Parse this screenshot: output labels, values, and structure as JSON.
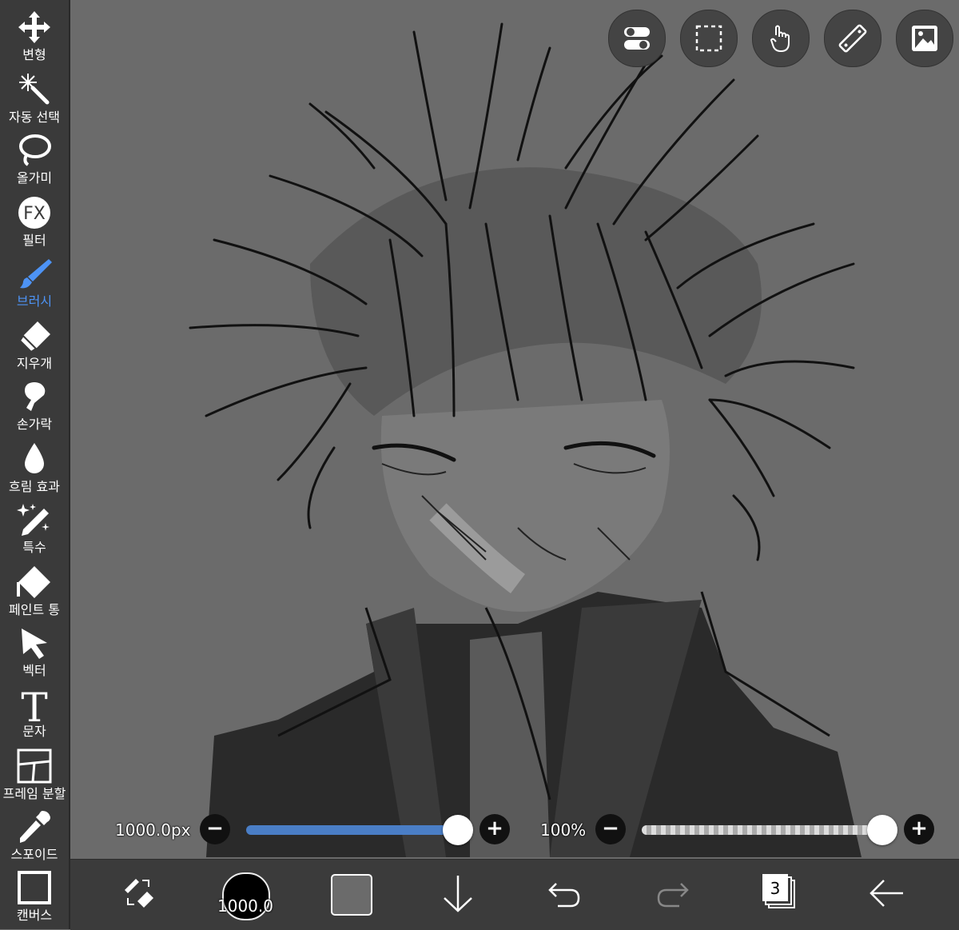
{
  "sidebar": {
    "tools": [
      {
        "id": "transform",
        "label": "변형",
        "icon": "move-arrows-icon"
      },
      {
        "id": "magic-wand",
        "label": "자동 선택",
        "icon": "magic-wand-icon"
      },
      {
        "id": "lasso",
        "label": "올가미",
        "icon": "lasso-icon"
      },
      {
        "id": "filter",
        "label": "필터",
        "icon": "fx-icon",
        "icon_text": "FX"
      },
      {
        "id": "brush",
        "label": "브러시",
        "icon": "brush-icon",
        "active": true
      },
      {
        "id": "eraser",
        "label": "지우개",
        "icon": "eraser-icon"
      },
      {
        "id": "smudge",
        "label": "손가락",
        "icon": "finger-icon"
      },
      {
        "id": "blur",
        "label": "흐림 효과",
        "icon": "droplet-icon"
      },
      {
        "id": "special",
        "label": "특수",
        "icon": "sparkle-pen-icon"
      },
      {
        "id": "fill",
        "label": "페인트 통",
        "icon": "paint-bucket-icon"
      },
      {
        "id": "vector",
        "label": "벡터",
        "icon": "cursor-arrow-icon"
      },
      {
        "id": "text",
        "label": "문자",
        "icon": "text-t-icon",
        "icon_text": "T"
      },
      {
        "id": "frame",
        "label": "프레임 분할",
        "icon": "frame-divide-icon"
      },
      {
        "id": "eyedropper",
        "label": "스포이드",
        "icon": "eyedropper-icon"
      },
      {
        "id": "canvas",
        "label": "캔버스",
        "icon": "canvas-square-icon"
      }
    ]
  },
  "top_buttons": [
    "toggle-icon",
    "selection-rect-icon",
    "touch-hand-icon",
    "ruler-icon",
    "image-icon"
  ],
  "sliders": {
    "size_value": "1000.0px",
    "size_fraction": 1.0,
    "opacity_value": "100%",
    "opacity_fraction": 1.0,
    "minus": "−",
    "plus": "+"
  },
  "bottom": {
    "brush_size": "1000.0",
    "layer_count": "3"
  },
  "colors": {
    "accent": "#4d93f5",
    "sidebar_bg": "#3a3a3a",
    "canvas_bg": "#6b6b6b",
    "secondary_color": "#6b6b6b",
    "primary_color": "#000000"
  }
}
